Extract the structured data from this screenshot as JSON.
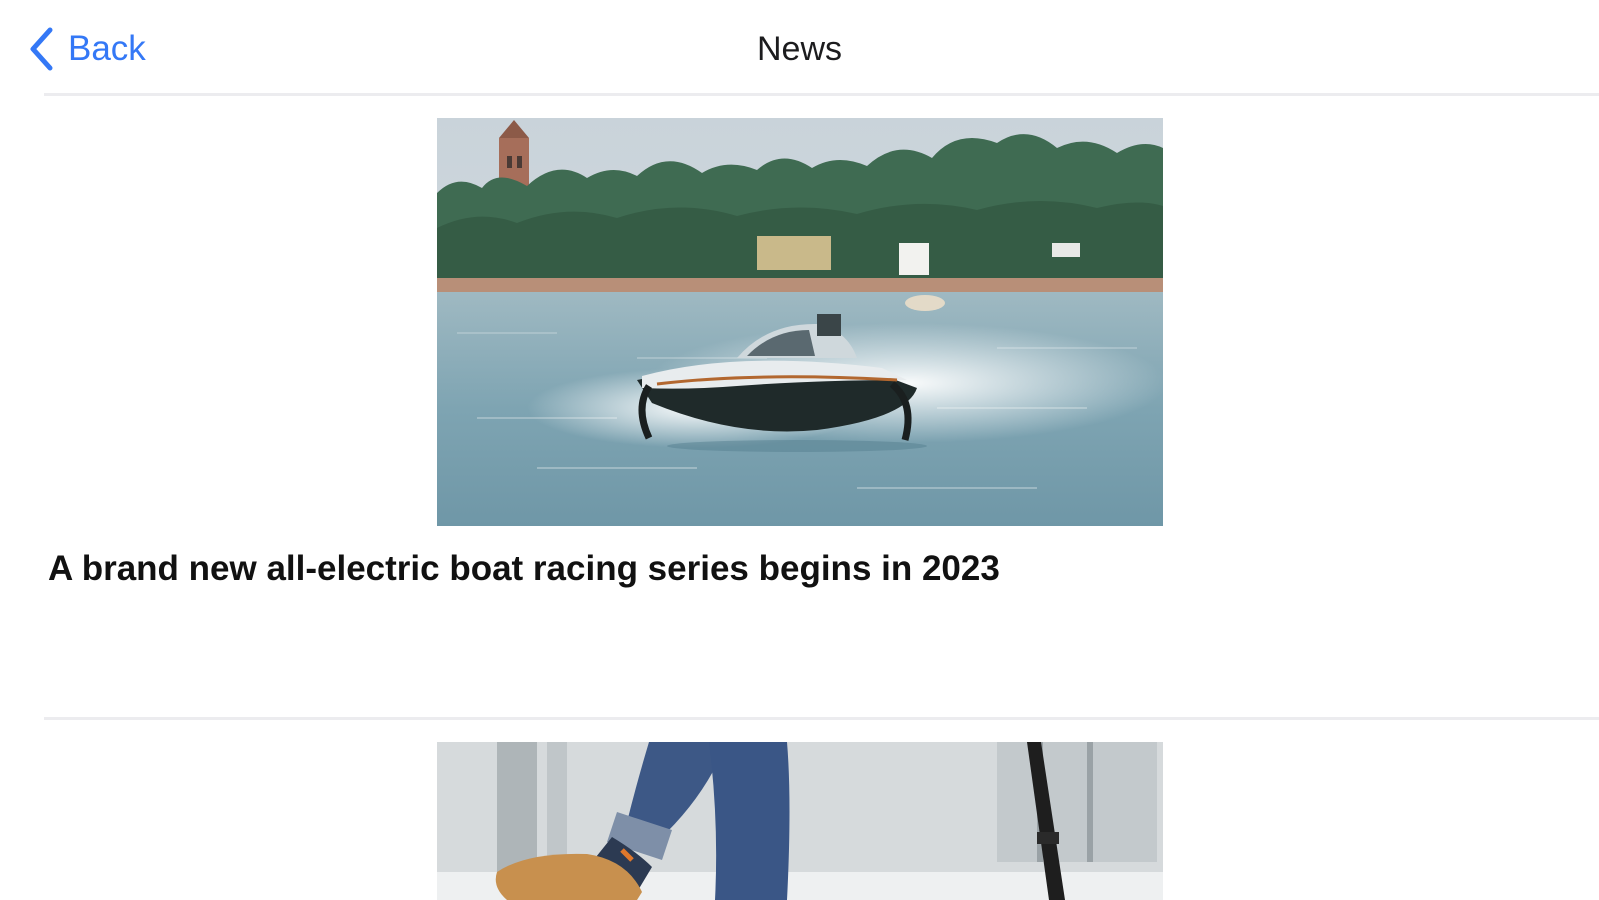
{
  "nav": {
    "back_label": "Back",
    "title": "News",
    "back_icon": "chevron-left-icon"
  },
  "colors": {
    "accent": "#3478f6",
    "title_text": "#111111",
    "separator": "#ececef",
    "background": "#ffffff"
  },
  "articles": [
    {
      "title": "A brand new all-electric boat racing series begins in 2023",
      "image": "electric-racing-boat-photo"
    },
    {
      "title": "",
      "image": "person-on-electric-scooter-photo"
    }
  ]
}
